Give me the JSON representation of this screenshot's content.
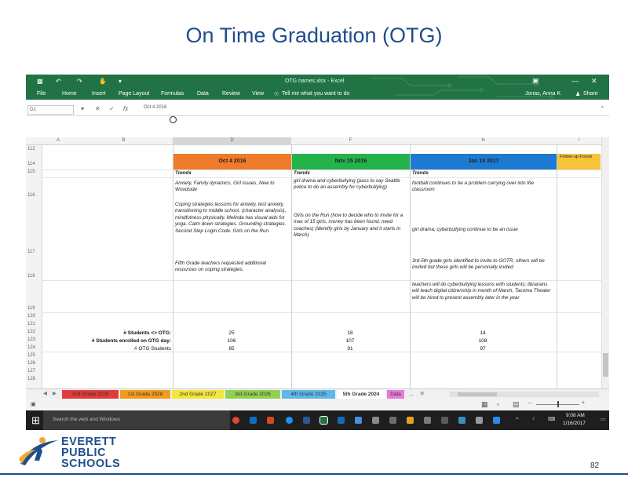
{
  "slide": {
    "title": "On Time Graduation (OTG)",
    "page_number": "82"
  },
  "excel": {
    "document_title": "OTG names.xlsx - Excel",
    "user": "Jonas, Anna K",
    "menu": [
      {
        "label": "File"
      },
      {
        "label": "Home"
      },
      {
        "label": "Insert"
      },
      {
        "label": "Page Layout"
      },
      {
        "label": "Formulas"
      },
      {
        "label": "Data"
      },
      {
        "label": "Review"
      },
      {
        "label": "View"
      },
      {
        "label": "Tell me what you want to do"
      },
      {
        "label": "Share"
      }
    ],
    "name_box": "D1",
    "formula_value": "Oct 4 2016",
    "columns": [
      "A",
      "B",
      "D",
      "F",
      "H",
      "I"
    ],
    "row_numbers": [
      "112",
      "114",
      "115",
      "116",
      "117",
      "118",
      "119",
      "120",
      "121",
      "122",
      "123",
      "124",
      "125",
      "126",
      "127",
      "128"
    ],
    "dates": [
      "Oct 4 2016",
      "Nov 15 2016",
      "Jan 10 2017",
      "Follow-up Forum"
    ],
    "trends_label": "Trends",
    "d_col_text": [
      "Anxiety, Family dynamics, Girl issues, New to Woodside",
      "Coping strategies lessons for anxiety, test anxiety, transitioning to middle school, (character analysis), mindfulness physically. Melinda has visual aids for yoga. Calm down strategies. Grounding strategies. Second Step Login Code. Girls on the Run.",
      "Fifth Grade teachers requested additional resources on coping strategies."
    ],
    "f_col_text": [
      "girl drama and cyberbullying (pass to say Seattle police to do an assembly for cyberbullying)",
      "Girls on the Run (how to decide who to invite for a max of 15 girls, money has been found, need coaches) (identify girls by January and it starts in March)"
    ],
    "h_col_text": [
      "football continues to be a problem carrying over into the classroom",
      "girl drama, cyberbullying continue to be an issue",
      "3rd-5th grade girls identified to invite to GOTR, others will be invited but these girls will be personally invited",
      "teachers will do cyberbullying lessons with students; librarians will teach digital citizenship in month of March, Tacoma Theater will be hired to present assembly later in the year"
    ],
    "summary": {
      "labels": [
        "# Students <> OTG:",
        "# Students enrolled on OTG day:",
        "# OTG Students"
      ],
      "d": [
        "25",
        "106",
        "85"
      ],
      "f": [
        "18",
        "107",
        "91"
      ],
      "h": [
        "14",
        "108",
        "97"
      ]
    },
    "sheet_tabs": [
      {
        "label": "2nd Grade 2029",
        "color": "#e23b3b"
      },
      {
        "label": "1st Grade 2028",
        "color": "#f39c1a"
      },
      {
        "label": "2nd Grade 2027",
        "color": "#f4e53c"
      },
      {
        "label": "3rd Grade 2026",
        "color": "#92d050"
      },
      {
        "label": "4th Grade 2025",
        "color": "#5fb8e8"
      },
      {
        "label": "5th Grade 2024",
        "color": "#f0f0f0"
      },
      {
        "label": "Data",
        "color": "#e87bd8"
      },
      {
        "label": "...",
        "color": "#f0f0f0"
      }
    ],
    "date_colors": [
      "#f07b2a",
      "#24b24b",
      "#1c7bd0",
      "#f5c43a"
    ],
    "zoom_symbol": "+",
    "taskbar": {
      "search_placeholder": "Search the web and Windows",
      "time": "9:08 AM",
      "date": "1/16/2017"
    }
  },
  "logo": {
    "line1": "EVERETT",
    "line2": "PUBLIC",
    "line3": "SCHOOLS"
  }
}
